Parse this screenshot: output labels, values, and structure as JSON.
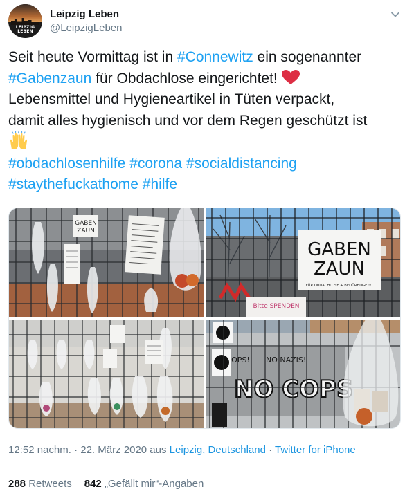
{
  "author": {
    "display_name": "Leipzig Leben",
    "handle": "@LeipzigLeben",
    "avatar_logo_line1": "LEIPZIG",
    "avatar_logo_line2": "LEBEN"
  },
  "tweet": {
    "l1_a": "Seit heute Vormittag ist in ",
    "l1_tag": "#Connewitz",
    "l1_b": " ein sogenannter",
    "l2_tag": "#Gabenzaun",
    "l2_b": " für Obdachlose eingerichtet!",
    "l3": " Lebensmittel und Hygieneartikel in Tüten verpackt,",
    "l4": "damit alles hygienisch und vor dem Regen geschützt ist",
    "hashtags": {
      "h1": "#obdachlosenhilfe",
      "h2": "#corona",
      "h3": "#socialdistancing",
      "h4": "#staythefuckathome",
      "h5": "#hilfe"
    },
    "emoji": {
      "heart": "red-heart",
      "hands": "raising-hands"
    }
  },
  "photos": {
    "sign_gaben": "GABEN",
    "sign_zaun": "ZAUN",
    "sign_small_line": "FÜR OBDACHLOSE + BEDÜRFTIGE !!!",
    "sign_bitte": "Bitte SPENDEN",
    "graffiti_nocops": "NO COPS!",
    "graffiti_nonazis": "NO NAZIS!",
    "graffiti_big": "NO COPS"
  },
  "meta": {
    "time": "12:52 nachm.",
    "sep1": " · ",
    "date": "22. März 2020",
    "from": " aus ",
    "location": "Leipzig, Deutschland",
    "sep2": " · ",
    "client": "Twitter for iPhone"
  },
  "stats": {
    "retweets_count": "288",
    "retweets_label": "Retweets",
    "likes_count": "842",
    "likes_label": "„Gefällt mir“-Angaben"
  },
  "colors": {
    "hashtag": "#1da1f2",
    "link": "#1b95e0",
    "secondary_text": "#657786",
    "heart": "#e0245e"
  }
}
